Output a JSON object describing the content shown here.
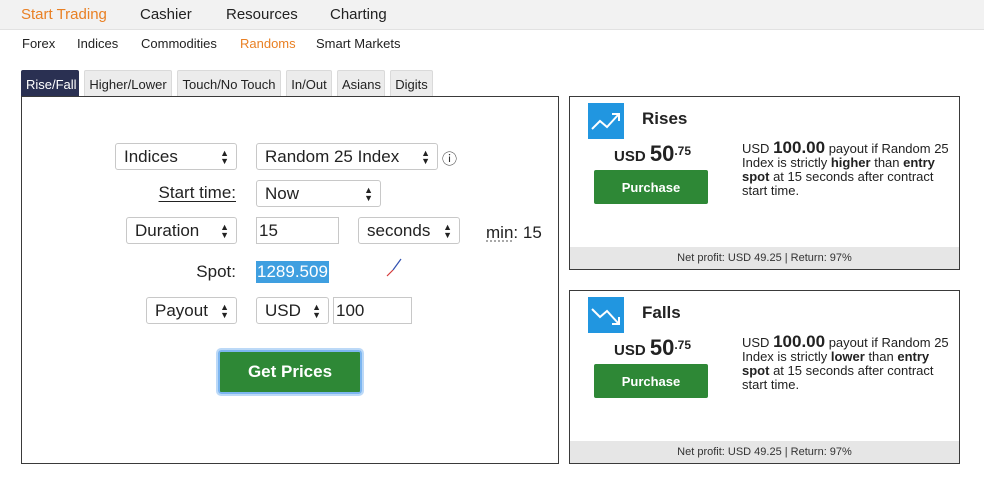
{
  "topnav": {
    "items": [
      "Start Trading",
      "Cashier",
      "Resources",
      "Charting"
    ],
    "active": "Start Trading"
  },
  "subnav": {
    "items": [
      "Forex",
      "Indices",
      "Commodities",
      "Randoms",
      "Smart Markets"
    ],
    "active": "Randoms"
  },
  "tabs": {
    "items": [
      "Rise/Fall",
      "Higher/Lower",
      "Touch/No Touch",
      "In/Out",
      "Asians",
      "Digits"
    ],
    "active": "Rise/Fall"
  },
  "form": {
    "market": "Indices",
    "underlying": "Random 25 Index",
    "start_time_label": "Start time:",
    "start_time": "Now",
    "duration_type": "Duration",
    "duration_value": "15",
    "duration_unit": "seconds",
    "min_label": "min",
    "min_sep": ":",
    "min_value": "15",
    "spot_label": "Spot:",
    "spot_value": "1289.509",
    "payout_type": "Payout",
    "currency": "USD",
    "amount": "100",
    "get_prices": "Get Prices",
    "info_icon": "ⓘ"
  },
  "cards": [
    {
      "title": "Rises",
      "currency": "USD",
      "price_int": "50",
      "price_dec": ".75",
      "purchase": "Purchase",
      "desc_cur": "USD",
      "desc_amt": "100.00",
      "desc_1": " payout if Random 25 Index is strictly ",
      "desc_dir": "higher",
      "desc_2": " than ",
      "desc_spot": "entry spot",
      "desc_3": " at 15 seconds after contract start time.",
      "footer": "Net profit: USD 49.25 | Return: 97%",
      "icon": "rise-chart-icon"
    },
    {
      "title": "Falls",
      "currency": "USD",
      "price_int": "50",
      "price_dec": ".75",
      "purchase": "Purchase",
      "desc_cur": "USD",
      "desc_amt": "100.00",
      "desc_1": " payout if Random 25 Index is strictly ",
      "desc_dir": "lower",
      "desc_2": " than ",
      "desc_spot": "entry spot",
      "desc_3": " at 15 seconds after contract start time.",
      "footer": "Net profit: USD 49.25 | Return: 97%",
      "icon": "fall-chart-icon"
    }
  ],
  "colors": {
    "accent": "#e98024",
    "tab_active": "#2a3052",
    "button_green": "#2e8836",
    "icon_blue": "#2196e0",
    "spot_highlight": "#3f9fe0"
  }
}
